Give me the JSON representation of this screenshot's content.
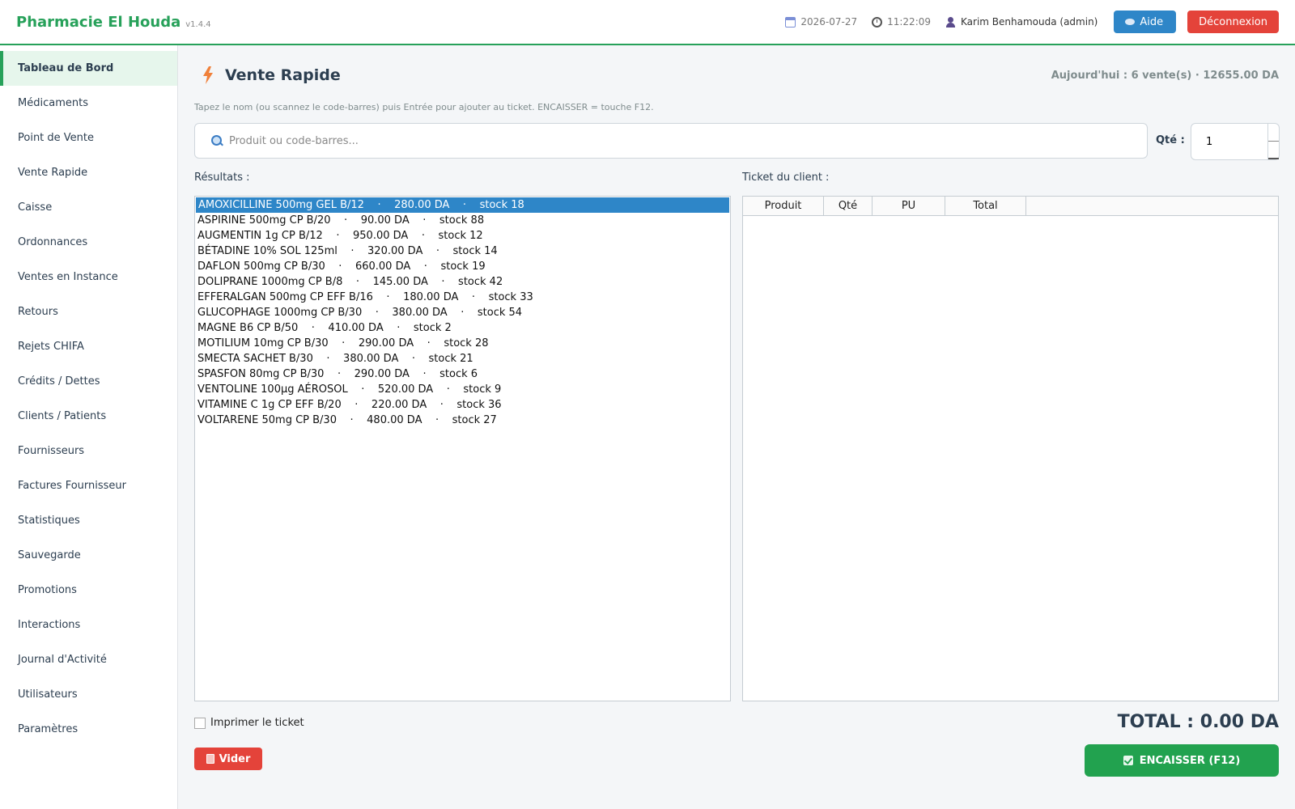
{
  "header": {
    "app_title": "Pharmacie El Houda",
    "version": "v1.4.4",
    "date": "2026-07-27",
    "time": "11:22:09",
    "user": "Karim Benhamouda (admin)",
    "help_label": "Aide",
    "logout_label": "Déconnexion"
  },
  "sidebar": {
    "items": [
      {
        "label": "Tableau de Bord"
      },
      {
        "label": "Médicaments"
      },
      {
        "label": "Point de Vente"
      },
      {
        "label": "Vente Rapide"
      },
      {
        "label": "Caisse"
      },
      {
        "label": "Ordonnances"
      },
      {
        "label": "Ventes en Instance"
      },
      {
        "label": "Retours"
      },
      {
        "label": "Rejets CHIFA"
      },
      {
        "label": "Crédits / Dettes"
      },
      {
        "label": "Clients / Patients"
      },
      {
        "label": "Fournisseurs"
      },
      {
        "label": "Factures Fournisseur"
      },
      {
        "label": "Statistiques"
      },
      {
        "label": "Sauvegarde"
      },
      {
        "label": "Promotions"
      },
      {
        "label": "Interactions"
      },
      {
        "label": "Journal d'Activité"
      },
      {
        "label": "Utilisateurs"
      },
      {
        "label": "Paramètres"
      }
    ],
    "active": "Tableau de Bord"
  },
  "main": {
    "title": "Vente Rapide",
    "today_summary": "Aujourd'hui : 6 vente(s) · 12655.00 DA",
    "hint": "Tapez le nom (ou scannez le code-barres) puis Entrée pour ajouter au ticket.  ENCAISSER = touche F12.",
    "search_placeholder": "Produit ou code-barres...",
    "search_value": "",
    "qty_label": "Qté :",
    "qty_value": "1",
    "results_label": "Résultats :",
    "ticket_label": "Ticket du client :",
    "results": [
      "AMOXICILLINE 500mg GEL B/12    ·    280.00 DA    ·    stock 18",
      "ASPIRINE 500mg CP B/20    ·    90.00 DA    ·    stock 88",
      "AUGMENTIN 1g CP B/12    ·    950.00 DA    ·    stock 12",
      "BÉTADINE 10% SOL 125ml    ·    320.00 DA    ·    stock 14",
      "DAFLON 500mg CP B/30    ·    660.00 DA    ·    stock 19",
      "DOLIPRANE 1000mg CP B/8    ·    145.00 DA    ·    stock 42",
      "EFFERALGAN 500mg CP EFF B/16    ·    180.00 DA    ·    stock 33",
      "GLUCOPHAGE 1000mg CP B/30    ·    380.00 DA    ·    stock 54",
      "MAGNE B6 CP B/50    ·    410.00 DA    ·    stock 2",
      "MOTILIUM 10mg CP B/30    ·    290.00 DA    ·    stock 28",
      "SMECTA SACHET B/30    ·    380.00 DA    ·    stock 21",
      "SPASFON 80mg CP B/30    ·    290.00 DA    ·    stock 6",
      "VENTOLINE 100µg AÉROSOL    ·    520.00 DA    ·    stock 9",
      "VITAMINE C 1g CP EFF B/20    ·    220.00 DA    ·    stock 36",
      "VOLTARENE 50mg CP B/30    ·    480.00 DA    ·    stock 27"
    ],
    "selected_result_index": 0,
    "ticket_columns": [
      "Produit",
      "Qté",
      "PU",
      "Total"
    ],
    "ticket_rows": [],
    "print_label": "Imprimer le ticket",
    "print_checked": false,
    "total": "TOTAL : 0.00 DA",
    "clear_label": "Vider",
    "pay_label": "ENCAISSER  (F12)"
  },
  "colors": {
    "brand": "#27a15a",
    "help_button": "#2e86c8",
    "danger": "#e4433a",
    "pay": "#22a24f",
    "selection": "#2e86c8"
  },
  "icons": [
    "calendar-icon",
    "clock-icon",
    "user-icon",
    "bubble-icon",
    "bolt-icon",
    "search-icon",
    "trash-icon",
    "check-icon"
  ]
}
